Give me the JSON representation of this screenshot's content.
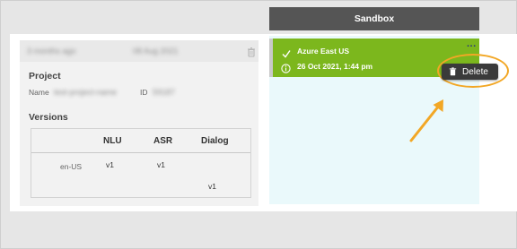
{
  "sandbox": {
    "header": "Sandbox",
    "item": {
      "region": "Azure East US",
      "datetime": "26 Oct 2021, 1:44 pm",
      "menu_label": "...",
      "delete_label": "Delete"
    }
  },
  "left_panel": {
    "header_left": "3 months ago",
    "header_right": "08 Aug 2021",
    "project_title": "Project",
    "name_label": "Name",
    "name_value": "test-project-name",
    "id_label": "ID",
    "id_value": "59187",
    "versions_title": "Versions",
    "versions_table": {
      "headers": [
        "NLU",
        "ASR",
        "Dialog"
      ],
      "rows": [
        {
          "locale": "en-US",
          "nlu": "v1",
          "asr": "v1",
          "dialog": ""
        },
        {
          "locale": "",
          "nlu": "",
          "asr": "",
          "dialog": "v1"
        }
      ]
    }
  },
  "colors": {
    "accent_green": "#7cb71d",
    "header_dark": "#555555",
    "sandbox_bg": "#eaf9fb",
    "callout_orange": "#f2a725",
    "menu_dark": "#3a3a3a"
  },
  "icons": [
    "trash-icon",
    "checkmark-icon",
    "info-icon",
    "more-options-icon"
  ]
}
